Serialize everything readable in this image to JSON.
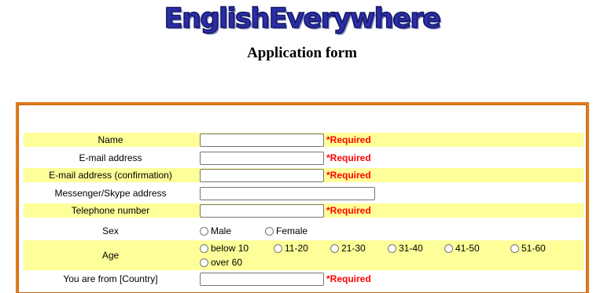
{
  "header": {
    "logo_text": "EnglishEverywhere",
    "subtitle": "Application form"
  },
  "colors": {
    "row_highlight": "#ffff99",
    "frame_border": "#e27b1a",
    "required_text": "#ff0000",
    "logo_blue": "#2b2ea8"
  },
  "form": {
    "required_label": "*Required",
    "name": {
      "label": "Name",
      "value": ""
    },
    "email": {
      "label": "E-mail address",
      "value": ""
    },
    "email_confirm": {
      "label": "E-mail address (confirmation)",
      "value": ""
    },
    "messenger": {
      "label": "Messenger/Skype address",
      "value": ""
    },
    "telephone": {
      "label": "Telephone number",
      "value": ""
    },
    "sex": {
      "label": "Sex",
      "options": [
        "Male",
        "Female"
      ]
    },
    "age": {
      "label": "Age",
      "options": [
        "below 10",
        "11-20",
        "21-30",
        "31-40",
        "41-50",
        "51-60",
        "over 60"
      ]
    },
    "country": {
      "label": "You are from [Country]",
      "value": ""
    }
  }
}
